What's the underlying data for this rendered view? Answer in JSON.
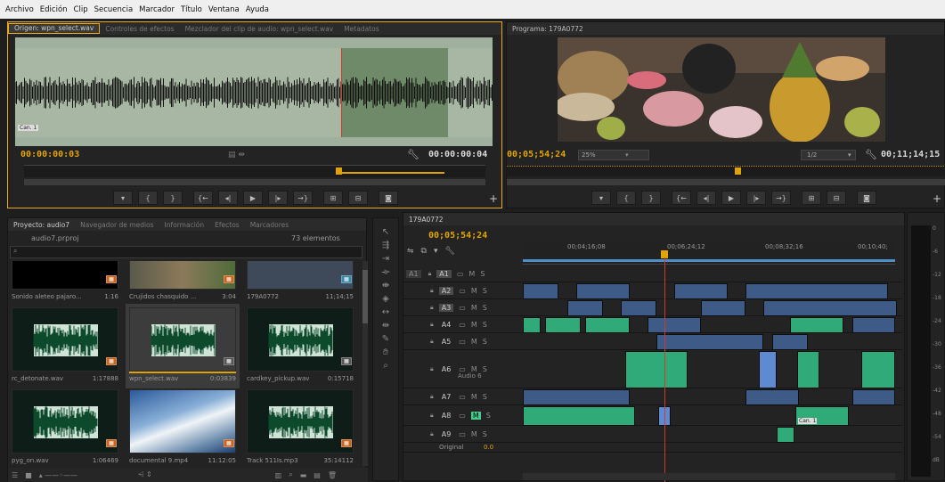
{
  "menu": [
    "Archivo",
    "Edición",
    "Clip",
    "Secuencia",
    "Marcador",
    "Título",
    "Ventana",
    "Ayuda"
  ],
  "source": {
    "tabs": [
      "Origen: wpn_select.wav",
      "Controles de efectos",
      "Mezclador del clip de audio: wpn_select.wav",
      "Metadatos"
    ],
    "channel": "Can. 1",
    "timecode": "00:00:00:03",
    "duration": "00:00:00:04"
  },
  "program": {
    "tab": "Programa: 179A0772",
    "timecode": "00;05;54;24",
    "zoom": "25%",
    "quality": "1/2",
    "duration": "00;11;14;15"
  },
  "project": {
    "tabs": [
      "Proyecto: audio7",
      "Navegador de medios",
      "Información",
      "Efectos",
      "Marcadores"
    ],
    "file": "audio7.prproj",
    "count": "73 elementos",
    "items": [
      {
        "name": "Sonido aleteo pajaro...",
        "dur": "1:16"
      },
      {
        "name": "Crujidos chasquido ...",
        "dur": "3:04"
      },
      {
        "name": "179A0772",
        "dur": "11;14;15"
      },
      {
        "name": "rc_detonate.wav",
        "dur": "1:17888"
      },
      {
        "name": "wpn_select.wav",
        "dur": "0:03839"
      },
      {
        "name": "cardkey_pickup.wav",
        "dur": "0:15718"
      },
      {
        "name": "pyg_on.wav",
        "dur": "1:06469"
      },
      {
        "name": "documental 9.mp4",
        "dur": "11:12:05"
      },
      {
        "name": "Track 511Is.mp3",
        "dur": "35:14112"
      }
    ]
  },
  "timeline": {
    "tab": "179A0772",
    "timecode": "00;05;54;24",
    "ruler": [
      "00;04;16;08",
      "00;06;24;12",
      "00;08;32;16",
      "00;10;40;"
    ],
    "tracks": [
      "A1",
      "A2",
      "A3",
      "A4",
      "A5",
      "A6",
      "A7",
      "A8",
      "A9"
    ],
    "src": "A1",
    "a6name": "Audio 6",
    "a8clip": "Can. 1",
    "master": "Original",
    "mval": "0.0",
    "meter": [
      "0",
      "-6",
      "-12",
      "-18",
      "-24",
      "-30",
      "-36",
      "-42",
      "-48",
      "-54",
      "dB"
    ]
  },
  "icons": [
    "wrench-icon",
    "add-icon",
    "play-icon",
    "camera-icon",
    "search-icon",
    "hand-icon",
    "razor-icon"
  ]
}
